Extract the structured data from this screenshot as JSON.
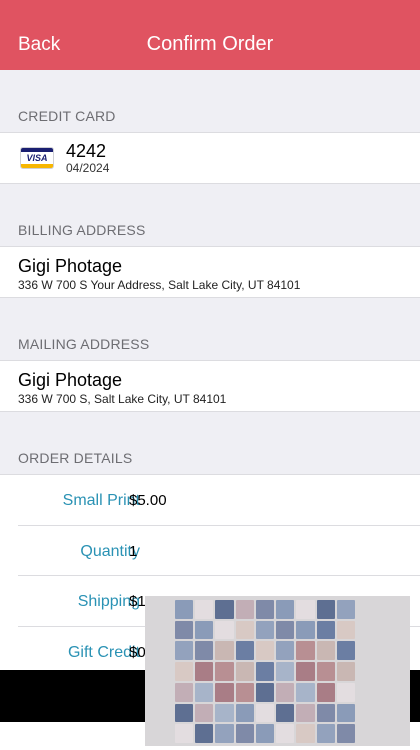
{
  "navbar": {
    "back_label": "Back",
    "title": "Confirm Order"
  },
  "credit_card": {
    "header": "CREDIT CARD",
    "brand_icon": "visa-card-icon",
    "brand_text": "VISA",
    "number": "4242",
    "expiry": "04/2024"
  },
  "billing": {
    "header": "BILLING ADDRESS",
    "name": "Gigi Photage",
    "address": "336 W 700 S Your Address, Salt Lake City, UT 84101"
  },
  "mailing": {
    "header": "MAILING ADDRESS",
    "name": "Gigi Photage",
    "address": "336 W 700 S, Salt Lake City, UT 84101"
  },
  "order": {
    "header": "ORDER DETAILS",
    "rows": [
      {
        "label": "Small Print",
        "value": "$5.00"
      },
      {
        "label": "Quantity",
        "value": "1"
      },
      {
        "label": "Shipping",
        "value": "$1"
      },
      {
        "label": "Gift Credit",
        "value": "$0"
      }
    ]
  },
  "colors": {
    "navbar": "#e05361",
    "detail_label": "#2a92b4",
    "background": "#efeff4"
  }
}
